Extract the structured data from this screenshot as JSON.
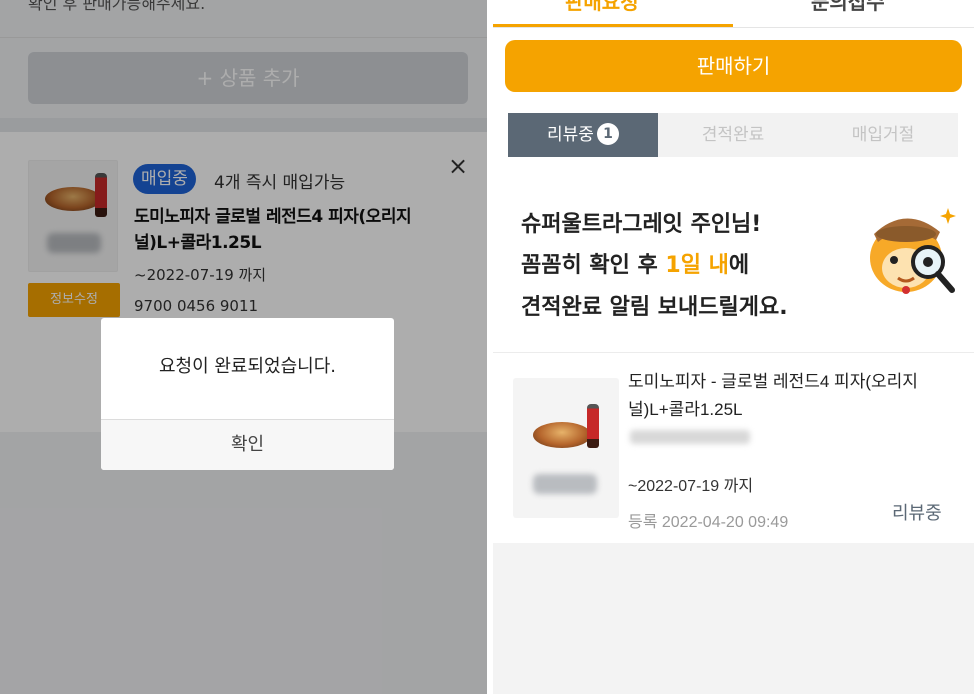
{
  "left_panel": {
    "top_partial_text": "확인 후 판매가능해주세요.",
    "add_product_label": "+ 상품 추가",
    "item": {
      "status_badge": "매입중",
      "status_note": "4개 즉시 매입가능",
      "title": "도미노피자 글로벌 레전드4 피자(오리지널)L+콜라1.25L",
      "expiry": "~2022-07-19 까지",
      "code": "9700 0456 9011",
      "edit_label": "정보수정",
      "close_symbol": "×"
    },
    "dialog": {
      "message": "요청이 완료되었습니다.",
      "confirm_label": "확인"
    }
  },
  "right_panel": {
    "tabs": [
      {
        "label": "판매요청",
        "active": true
      },
      {
        "label": "문의접수",
        "active": false
      }
    ],
    "sell_button_label": "판매하기",
    "filters": [
      {
        "label": "리뷰중",
        "count": "1",
        "active": true
      },
      {
        "label": "견적완료",
        "active": false
      },
      {
        "label": "매입거절",
        "active": false
      }
    ],
    "banner": {
      "line1": "슈퍼울트라그레잇 주인님!",
      "line2_pre": "꼼꼼히 확인 후 ",
      "line2_highlight": "1일 내",
      "line2_post": "에",
      "line3": "견적완료 알림 보내드릴게요."
    },
    "list_item": {
      "title": "도미노피자 - 글로벌 레전드4 피자(오리지널)L+콜라1.25L",
      "expiry": "~2022-07-19 까지",
      "registered": "등록 2022-04-20 09:49",
      "status": "리뷰중"
    }
  },
  "colors": {
    "accent": "#f5a300",
    "status_blue": "#1e64d8",
    "filter_active": "#5b6875"
  },
  "icons": [
    "close-icon",
    "mascot-detective-icon"
  ]
}
